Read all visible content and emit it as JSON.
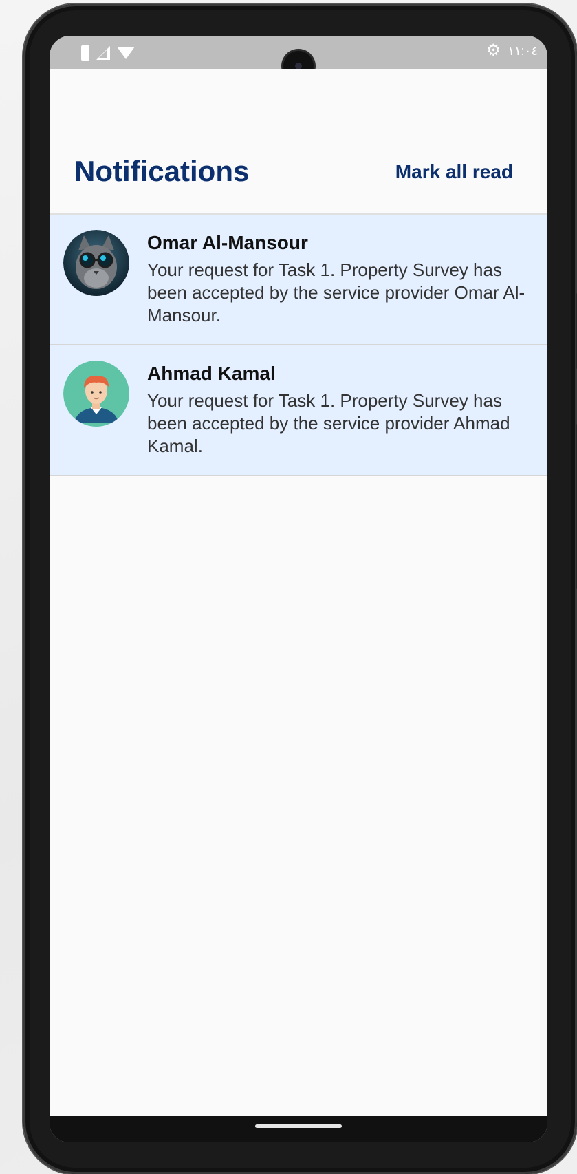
{
  "status_bar": {
    "time": "١١:٠٤",
    "icons": [
      "battery-icon",
      "cell-signal-icon",
      "wifi-icon",
      "settings-gear-icon"
    ]
  },
  "header": {
    "title": "Notifications",
    "mark_all_read": "Mark all read"
  },
  "notifications": [
    {
      "name": "Omar Al-Mansour",
      "message": "Your request for Task 1. Property Survey has been accepted by the service provider Omar Al-Mansour.",
      "avatar": "cat-sunglasses-avatar",
      "unread": true
    },
    {
      "name": "Ahmad Kamal",
      "message": "Your request for Task 1. Property Survey has been accepted by the service provider Ahmad Kamal.",
      "avatar": "man-cartoon-avatar",
      "unread": true
    }
  ],
  "colors": {
    "accent": "#0c2f6e",
    "unread_background": "#e4efff",
    "status_bar": "#bdbdbd"
  }
}
